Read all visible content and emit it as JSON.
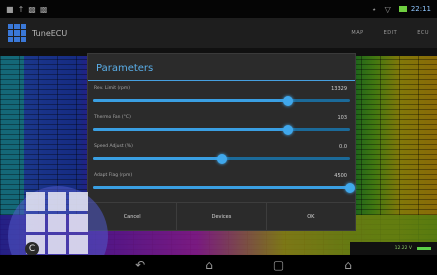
{
  "status_bar": {
    "icons_left": [
      "notification-icon",
      "sync-icon",
      "image-icon",
      "image-icon"
    ],
    "time": "22:11"
  },
  "app": {
    "title": "TuneECU",
    "actions": [
      "MAP",
      "EDIT",
      "ECU"
    ]
  },
  "dialog": {
    "title": "Parameters",
    "params": [
      {
        "label": "Rev. Limit (rpm)",
        "value": "13329",
        "fraction": 0.76
      },
      {
        "label": "Thermo Fan (°C)",
        "value": "103",
        "fraction": 0.76
      },
      {
        "label": "Speed Adjust (%)",
        "value": "0.0",
        "fraction": 0.5
      },
      {
        "label": "Adapt Flag (rpm)",
        "value": "4500",
        "fraction": 1.0
      }
    ],
    "buttons": {
      "cancel": "Cancel",
      "devices": "Devices",
      "ok": "OK"
    }
  },
  "launcher": {
    "badge": "C"
  },
  "bottom_strip": {
    "text": "12.22 V"
  },
  "nav_bar": {
    "back": "↶",
    "home": "⌂",
    "recent": "▢",
    "menu": "⌂"
  },
  "colors": {
    "accent": "#3a9fe2",
    "title": "#5aaee8"
  }
}
